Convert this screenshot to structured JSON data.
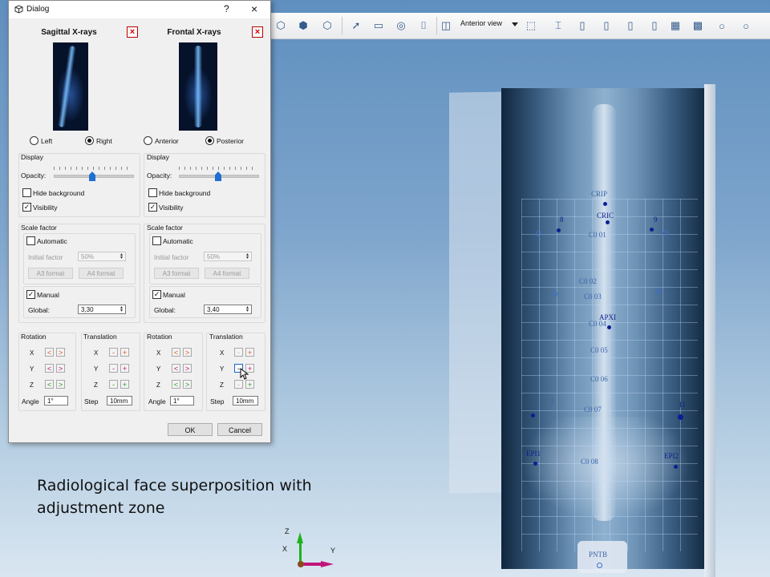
{
  "dialog": {
    "title": "Dialog",
    "help": "?",
    "close": "×",
    "ok_label": "OK",
    "cancel_label": "Cancel",
    "panes": [
      {
        "title": "Sagittal X-rays",
        "remove": "×",
        "orientation": {
          "option_a": "Left",
          "option_b": "Right",
          "selected": "Right"
        },
        "display": {
          "label": "Display",
          "opacity_label": "Opacity:",
          "opacity": 0.62,
          "hide_background_label": "Hide background",
          "hide_background": false,
          "visibility_label": "Visibility",
          "visibility": true
        },
        "scale": {
          "label": "Scale factor",
          "automatic_label": "Automatic",
          "automatic": false,
          "initial_factor_label": "Initial factor",
          "initial_factor": "50%",
          "a3_label": "A3 format",
          "a4_label": "A4 format",
          "manual_label": "Manual",
          "manual": true,
          "global_label": "Global:",
          "global": "3,30"
        },
        "rotation": {
          "label": "Rotation",
          "x": "X",
          "y": "Y",
          "z": "Z",
          "angle_label": "Angle",
          "angle": "1°"
        },
        "translation": {
          "label": "Translation",
          "x": "X",
          "y": "Y",
          "z": "Z",
          "step_label": "Step",
          "step": "10mm"
        }
      },
      {
        "title": "Frontal X-rays",
        "remove": "×",
        "orientation": {
          "option_a": "Anterior",
          "option_b": "Posterior",
          "selected": "Posterior"
        },
        "display": {
          "label": "Display",
          "opacity_label": "Opacity:",
          "opacity": 0.62,
          "hide_background_label": "Hide background",
          "hide_background": false,
          "visibility_label": "Visibility",
          "visibility": true
        },
        "scale": {
          "label": "Scale factor",
          "automatic_label": "Automatic",
          "automatic": false,
          "initial_factor_label": "Initial factor",
          "initial_factor": "50%",
          "a3_label": "A3 format",
          "a4_label": "A4 format",
          "manual_label": "Manual",
          "manual": true,
          "global_label": "Global:",
          "global": "3,40"
        },
        "rotation": {
          "label": "Rotation",
          "x": "X",
          "y": "Y",
          "z": "Z",
          "angle_label": "Angle",
          "angle": "1°"
        },
        "translation": {
          "label": "Translation",
          "x": "X",
          "y": "Y",
          "z": "Z",
          "step_label": "Step",
          "step": "10mm"
        }
      }
    ]
  },
  "buttons": {
    "lt": "<",
    "gt": ">",
    "minus": "-",
    "plus": "+"
  },
  "toolbar": {
    "view_label": "Anterior view"
  },
  "landmarks": {
    "crip": "CRIP",
    "cric": "CRIC",
    "left_rib": "8",
    "right_rib": "9",
    "c01": "C0 01",
    "c02": "C0 02",
    "c03": "C0 03",
    "apxi": "APXI",
    "c04": "C0 04",
    "c05": "C0 05",
    "c06": "C0 06",
    "c07": "C0 07",
    "c08": "C0 08",
    "epi1": "EPI1",
    "epi2": "EPI2",
    "pntb": "PNTB",
    "left_small": "5",
    "right_small": "11"
  },
  "axes": {
    "x": "X",
    "y": "Y",
    "z": "Z"
  },
  "caption": {
    "line1": "Radiological face superposition with",
    "line2": "adjustment zone"
  }
}
